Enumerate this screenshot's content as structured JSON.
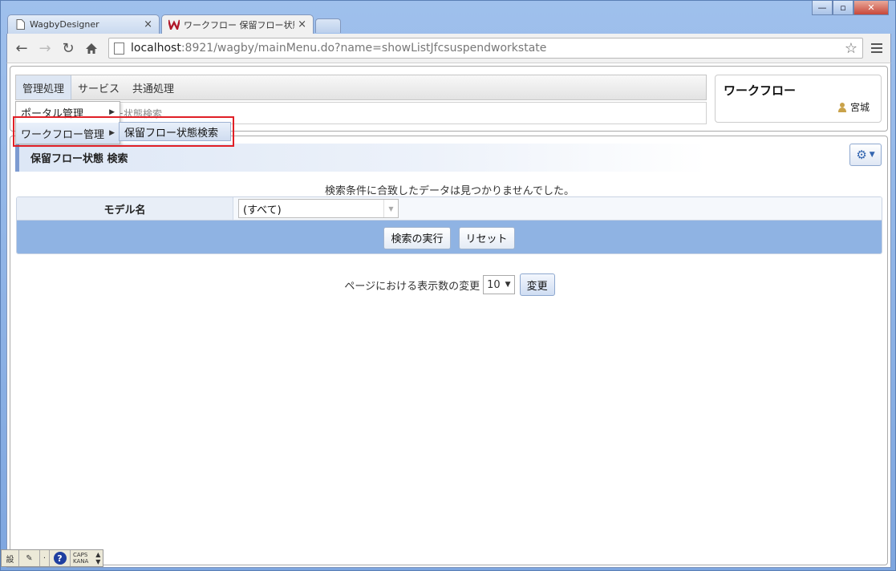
{
  "window": {
    "controls": {
      "minimize": "—",
      "maximize": "▫",
      "close": "✕"
    }
  },
  "tabs": [
    {
      "title": "WagbyDesigner",
      "close": "×"
    },
    {
      "title": "ワークフロー 保留フロー状態検",
      "close": "×"
    }
  ],
  "toolbar": {
    "url_host": "localhost",
    "url_rest": ":8921/wagby/mainMenu.do?name=showListJfcsuspendworkstate"
  },
  "menubar": {
    "items": [
      "管理処理",
      "サービス",
      "共通処理"
    ]
  },
  "breadcrumb": {
    "text": "ロー状態検索"
  },
  "user_box": {
    "title": "ワークフロー",
    "user": "宮城"
  },
  "dropdown": {
    "items": [
      {
        "label": "ポータル管理",
        "arrow": "▶"
      },
      {
        "label": "ワークフロー管理",
        "arrow": "▶"
      }
    ],
    "submenu_item": "保留フロー状態検索"
  },
  "section": {
    "title": "保留フロー状態 検索"
  },
  "message": "検索条件に合致したデータは見つかりませんでした。",
  "search": {
    "field_label": "モデル名",
    "select_value": "(すべて)",
    "buttons": {
      "execute": "検索の実行",
      "reset": "リセット"
    }
  },
  "pager": {
    "label": "ページにおける表示数の変更",
    "page_size": "10",
    "change_button": "変更"
  },
  "ime": {
    "caps": "CAPS",
    "kana": "KANA"
  },
  "colors": {
    "window_frame": "#8fb2e6",
    "section_accent": "#7d9bd1",
    "button_bar": "#8fb3e3",
    "highlight": "#e01f26"
  }
}
